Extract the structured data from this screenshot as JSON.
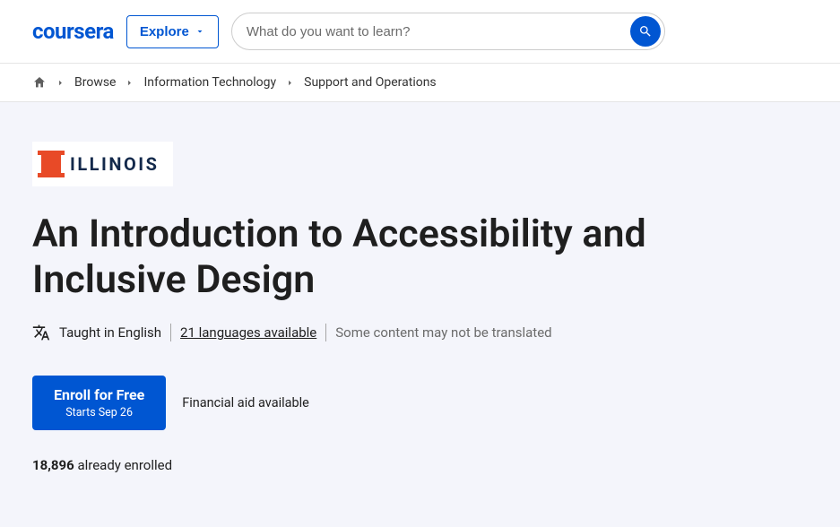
{
  "header": {
    "logo": "coursera",
    "explore": "Explore",
    "search_placeholder": "What do you want to learn?"
  },
  "breadcrumb": [
    "Browse",
    "Information Technology",
    "Support and Operations"
  ],
  "partner": {
    "name": "ILLINOIS"
  },
  "course": {
    "title": "An Introduction to Accessibility and Inclusive Design",
    "taught_in": "Taught in English",
    "languages_link": "21 languages available",
    "translation_note": "Some content may not be translated",
    "enroll_label": "Enroll for Free",
    "enroll_sub": "Starts Sep 26",
    "financial_aid": "Financial aid available",
    "enrolled_count": "18,896",
    "enrolled_suffix": " already enrolled"
  }
}
